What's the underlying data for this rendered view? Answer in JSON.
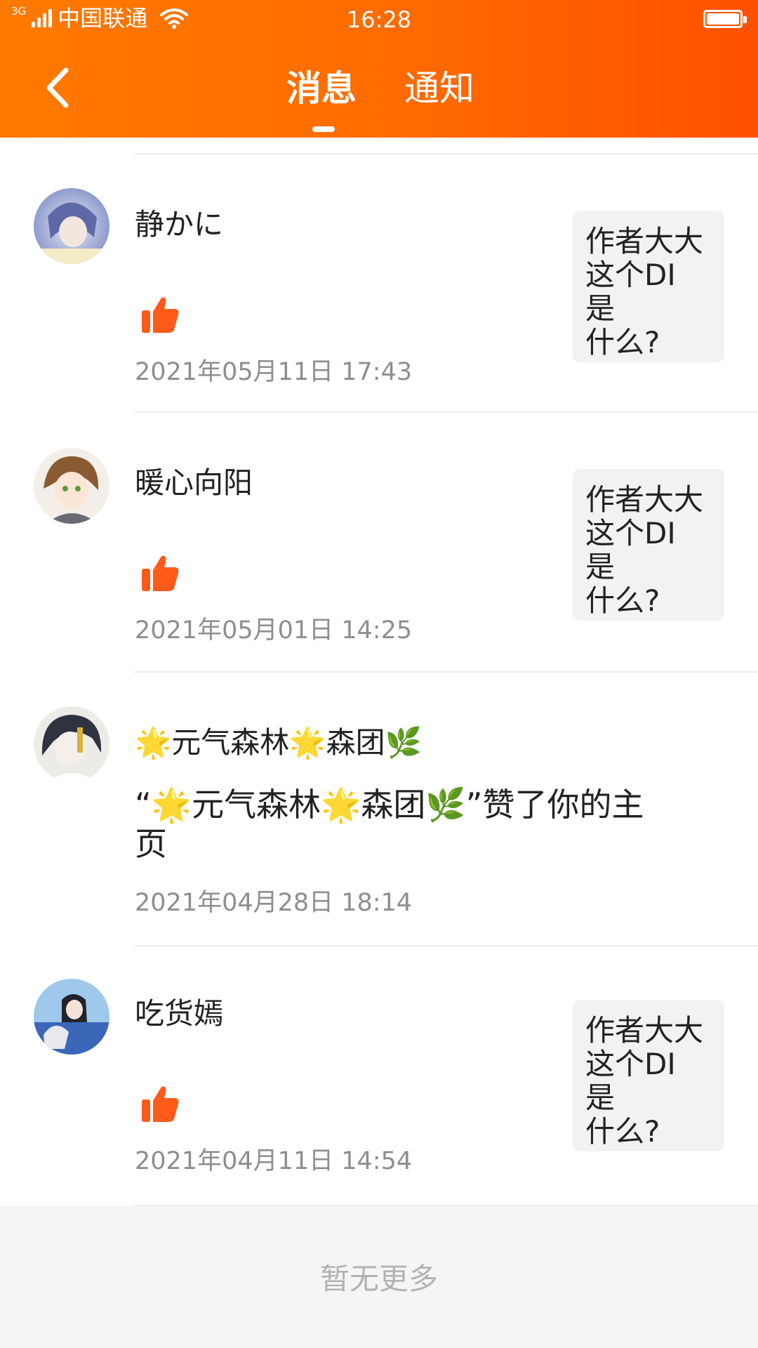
{
  "status_bar": {
    "network": "3G",
    "carrier": "中国联通",
    "time": "16:28"
  },
  "header": {
    "tabs": [
      {
        "label": "消息",
        "active": true
      },
      {
        "label": "通知",
        "active": false
      }
    ],
    "accent_color": "#ff6a00"
  },
  "items": [
    {
      "username": "静かに",
      "action": "like",
      "quote": "作者大大\n这个DI 是\n什么?",
      "time": "2021年05月11日 17:43"
    },
    {
      "username": "暖心向阳",
      "action": "like",
      "quote": "作者大大\n这个DI 是\n什么?",
      "time": "2021年05月01日 14:25"
    },
    {
      "username": "🌟元气森林🌟森团🌿",
      "action": "profile_like",
      "text": "“🌟元气森林🌟森团🌿”赞了你的主页",
      "time": "2021年04月28日 18:14"
    },
    {
      "username": "吃货嫣",
      "action": "like",
      "quote": "作者大大\n这个DI 是\n什么?",
      "time": "2021年04月11日 14:54"
    }
  ],
  "footer": {
    "text": "暂无更多"
  }
}
